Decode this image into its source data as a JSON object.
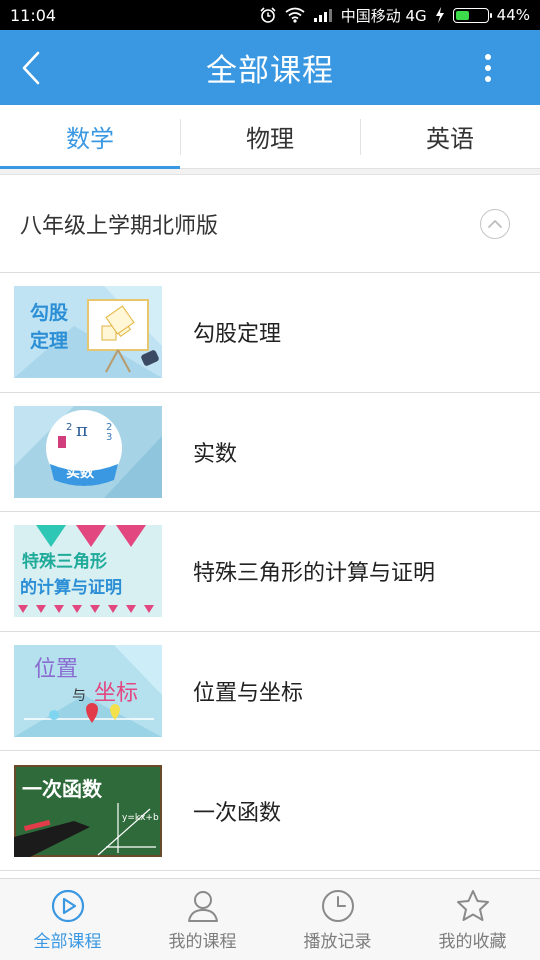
{
  "status_bar": {
    "time": "11:04",
    "carrier": "中国移动 4G",
    "battery_percent": "44%",
    "battery_level": 0.44
  },
  "header": {
    "title": "全部课程",
    "back_icon": "chevron-left-icon",
    "more_icon": "more-vertical-icon"
  },
  "tabs": [
    {
      "label": "数学",
      "active": true
    },
    {
      "label": "物理",
      "active": false
    },
    {
      "label": "英语",
      "active": false
    }
  ],
  "section": {
    "title": "八年级上学期北师版",
    "toggle_icon": "chevron-up-icon"
  },
  "courses": [
    {
      "name": "勾股定理",
      "thumb_text": [
        "勾股",
        "定理"
      ]
    },
    {
      "name": "实数",
      "thumb_text": [
        "实数",
        "π"
      ]
    },
    {
      "name": "特殊三角形的计算与证明",
      "thumb_text": [
        "特殊三角形",
        "的计算与证明"
      ]
    },
    {
      "name": "位置与坐标",
      "thumb_text": [
        "位置",
        "与",
        "坐标"
      ]
    },
    {
      "name": "一次函数",
      "thumb_text": [
        "一次函数",
        "y=kx+b"
      ]
    }
  ],
  "bottom_nav": [
    {
      "label": "全部课程",
      "icon": "play-circle-icon",
      "active": true
    },
    {
      "label": "我的课程",
      "icon": "user-icon",
      "active": false
    },
    {
      "label": "播放记录",
      "icon": "clock-icon",
      "active": false
    },
    {
      "label": "我的收藏",
      "icon": "star-icon",
      "active": false
    }
  ],
  "colors": {
    "accent": "#3a98e2",
    "status_bar": "#000000",
    "battery": "#3ddc4a"
  }
}
